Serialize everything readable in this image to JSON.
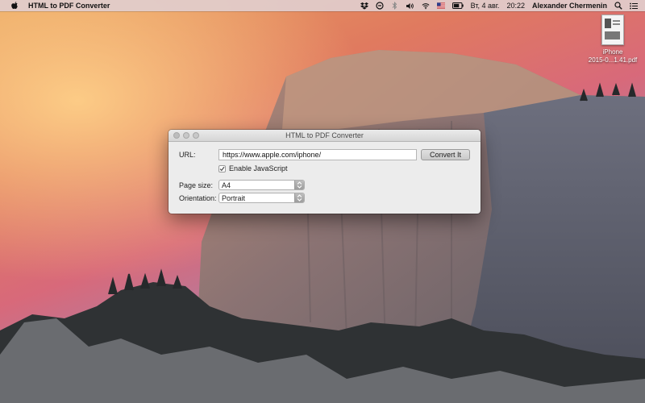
{
  "menubar": {
    "app_name": "HTML to PDF Converter",
    "date": "Вт, 4 авг.",
    "time": "20:22",
    "user": "Alexander Chermenin",
    "icons": [
      "apple-icon",
      "dropbox-icon",
      "sync-icon",
      "bluetooth-icon",
      "volume-icon",
      "wifi-icon",
      "flag-icon",
      "battery-icon",
      "search-icon",
      "notification-list-icon"
    ]
  },
  "desktop_file": {
    "name_line1": "iPhone",
    "name_line2": "2015-0...1.41.pdf"
  },
  "window": {
    "title": "HTML to PDF Converter",
    "url_label": "URL:",
    "url_value": "https://www.apple.com/iphone/",
    "convert_label": "Convert It",
    "js_label": "Enable JavaScript",
    "js_checked": true,
    "page_size_label": "Page size:",
    "page_size_value": "A4",
    "orientation_label": "Orientation:",
    "orientation_value": "Portrait"
  },
  "colors": {
    "sky_top": "#e8a25e",
    "sky_mid": "#d8697a",
    "sky_right": "#7d86b8",
    "rock": "#6e6a6c",
    "window_bg": "#ececec"
  }
}
